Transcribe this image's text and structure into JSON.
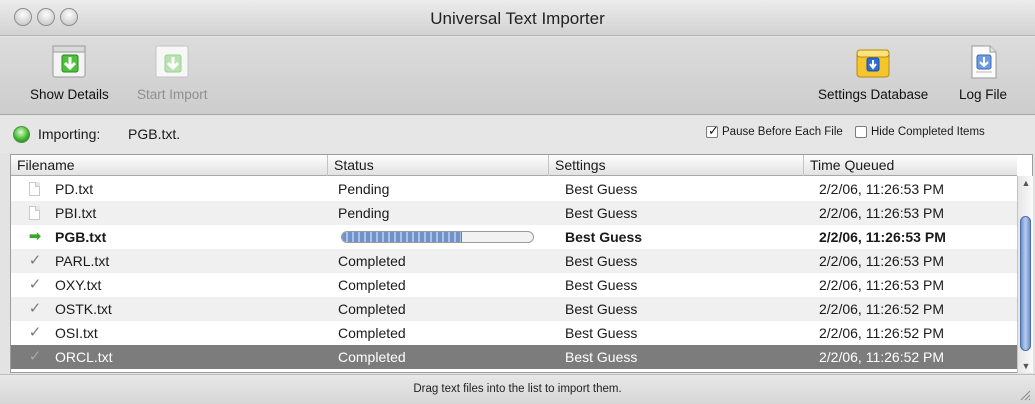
{
  "window": {
    "title": "Universal Text Importer"
  },
  "toolbar": {
    "show_details": "Show Details",
    "start_import": "Start Import",
    "settings_database": "Settings Database",
    "log_file": "Log File"
  },
  "status": {
    "label": "Importing:",
    "file": "PGB.txt.",
    "pause_before_each_file": "Pause Before Each File",
    "pause_checked": true,
    "hide_completed_items": "Hide Completed Items",
    "hide_checked": false
  },
  "table": {
    "columns": [
      "Filename",
      "Status",
      "Settings",
      "Time Queued"
    ],
    "rows": [
      {
        "icon": "document-icon",
        "filename": "PD.txt",
        "status": "Pending",
        "settings": "Best Guess",
        "time": "2/2/06, 11:26:53 PM"
      },
      {
        "icon": "document-icon",
        "filename": "PBI.txt",
        "status": "Pending",
        "settings": "Best Guess",
        "time": "2/2/06, 11:26:53 PM"
      },
      {
        "icon": "arrow-icon",
        "filename": "PGB.txt",
        "status": "",
        "progress": 0.63,
        "settings": "Best Guess",
        "time": "2/2/06, 11:26:53 PM"
      },
      {
        "icon": "check-icon",
        "filename": "PARL.txt",
        "status": "Completed",
        "settings": "Best Guess",
        "time": "2/2/06, 11:26:53 PM"
      },
      {
        "icon": "check-icon",
        "filename": "OXY.txt",
        "status": "Completed",
        "settings": "Best Guess",
        "time": "2/2/06, 11:26:53 PM"
      },
      {
        "icon": "check-icon",
        "filename": "OSTK.txt",
        "status": "Completed",
        "settings": "Best Guess",
        "time": "2/2/06, 11:26:52 PM"
      },
      {
        "icon": "check-icon",
        "filename": "OSI.txt",
        "status": "Completed",
        "settings": "Best Guess",
        "time": "2/2/06, 11:26:52 PM"
      },
      {
        "icon": "check-icon",
        "filename": "ORCL.txt",
        "status": "Completed",
        "settings": "Best Guess",
        "time": "2/2/06, 11:26:52 PM"
      }
    ]
  },
  "footer": {
    "hint": "Drag text files into the list to import them."
  },
  "colors": {
    "selection": "#7c7c7c",
    "progress": "#6f93c9",
    "led": "#3ab12a"
  }
}
